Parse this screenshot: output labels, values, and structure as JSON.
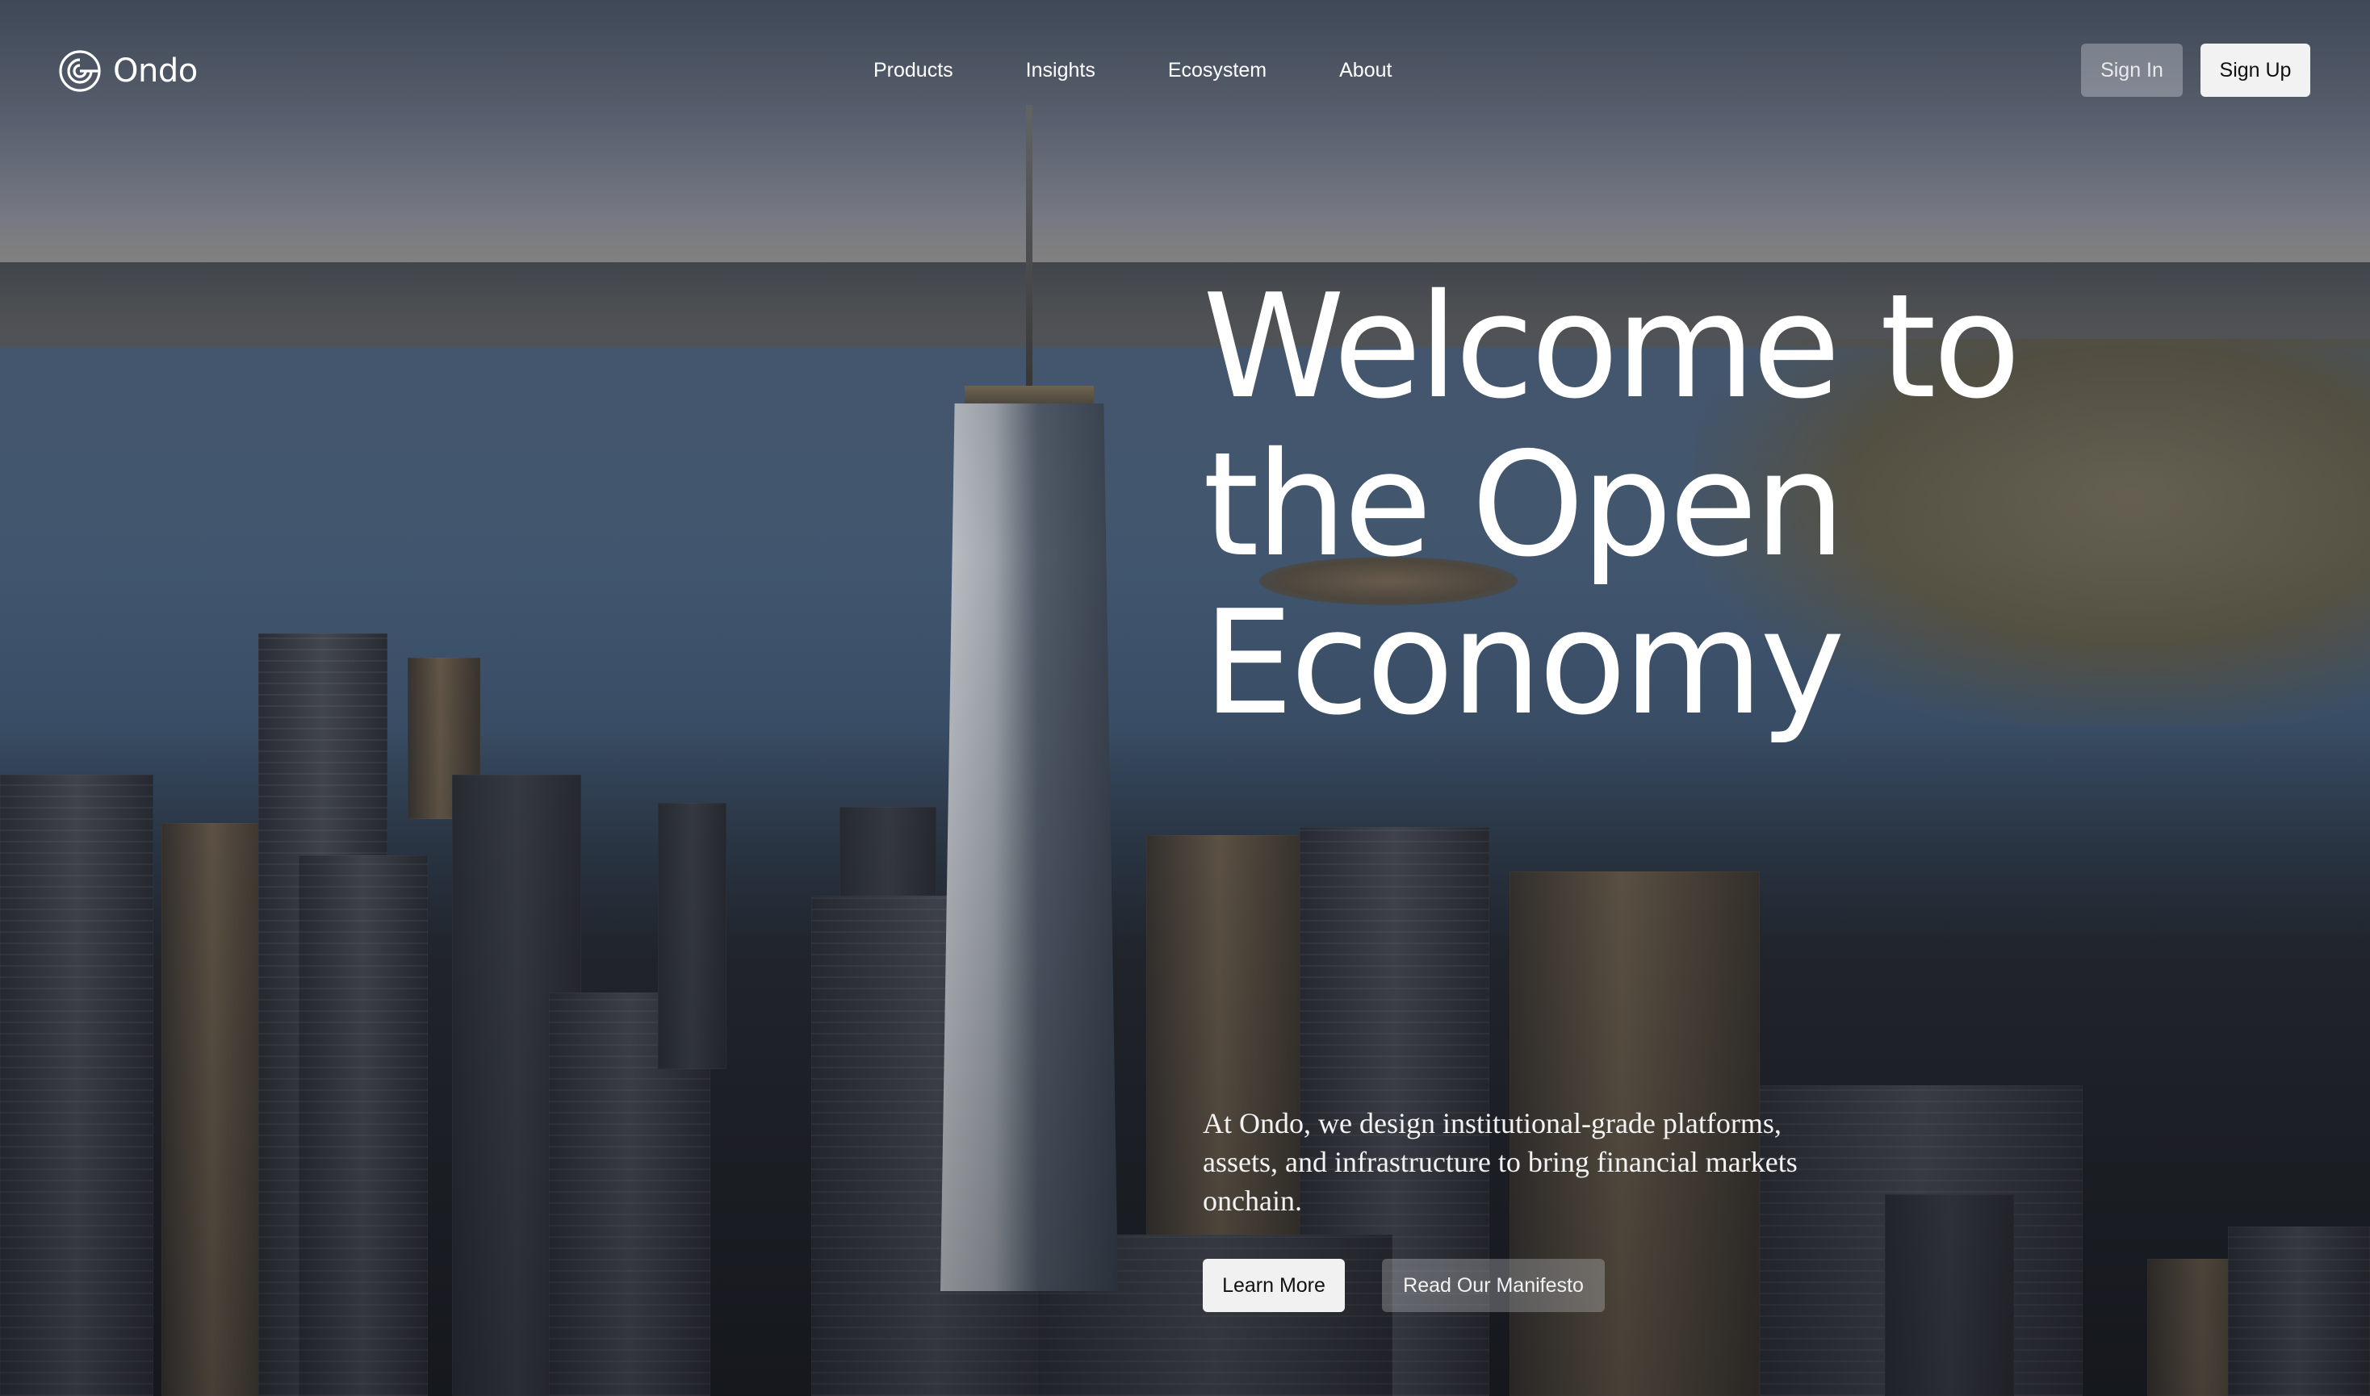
{
  "brand": {
    "name": "Ondo",
    "logo_icon": "ondo-concentric-circle-logo"
  },
  "nav": {
    "links": [
      {
        "label": "Products"
      },
      {
        "label": "Insights"
      },
      {
        "label": "Ecosystem"
      },
      {
        "label": "About"
      }
    ],
    "sign_in_label": "Sign In",
    "sign_up_label": "Sign Up"
  },
  "hero": {
    "headline_lines": [
      "Welcome to",
      "the Open",
      "Economy"
    ],
    "subtext": "At Ondo, we design institutional-grade platforms, assets, and infrastructure to bring financial markets onchain.",
    "primary_cta": "Learn More",
    "secondary_cta": "Read Our Manifesto"
  },
  "colors": {
    "text": "#ffffff",
    "primary_button_bg": "#f2f2f2",
    "secondary_button_bg": "rgba(220,222,226,0.35)"
  }
}
